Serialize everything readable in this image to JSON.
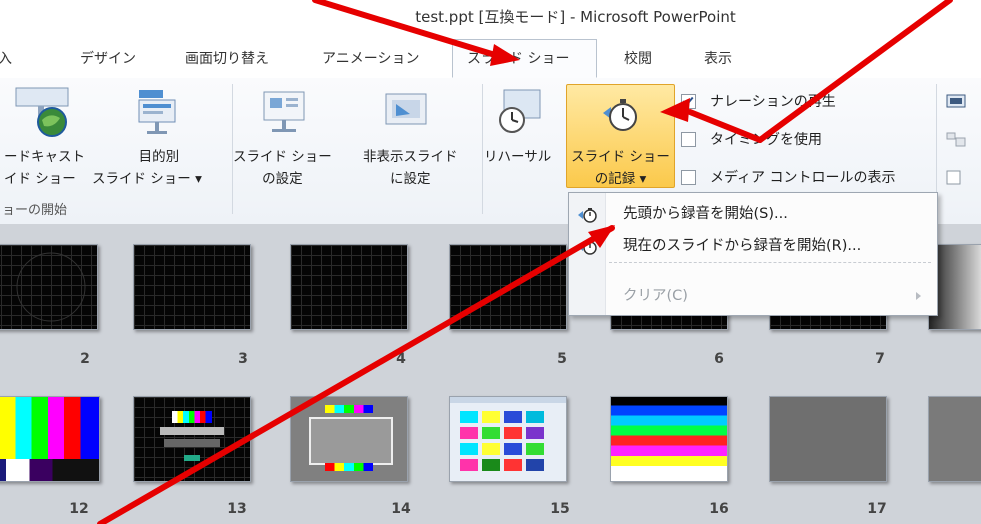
{
  "window": {
    "title": "test.ppt [互換モード] - Microsoft PowerPoint"
  },
  "tabs": [
    {
      "label": "挿入",
      "visible_label": "挿入"
    },
    {
      "label": "デザイン"
    },
    {
      "label": "画面切り替え"
    },
    {
      "label": "アニメーション"
    },
    {
      "label": "スライド ショー",
      "active": true
    },
    {
      "label": "校閲"
    },
    {
      "label": "表示"
    }
  ],
  "ribbon": {
    "broadcast": {
      "line1": "ードキャスト",
      "line2": "イド ショー"
    },
    "custom_show": {
      "line1": "目的別",
      "line2": "スライド ショー ▾"
    },
    "group_start_label": "ョーの開始",
    "setup_show": {
      "line1": "スライド ショー",
      "line2": "の設定"
    },
    "hide_slide": {
      "line1": "非表示スライド",
      "line2": "に設定"
    },
    "rehearse": {
      "label": "リハーサル"
    },
    "record": {
      "line1": "スライド ショー",
      "line2": "の記録 ▾"
    },
    "checks": [
      {
        "label": "ナレーションの再生",
        "checked": true
      },
      {
        "label": "タイミングを使用",
        "checked": false
      },
      {
        "label": "メディア コントロールの表示",
        "checked": false
      }
    ]
  },
  "menu": {
    "items": [
      {
        "label": "先頭から録音を開始(S)...",
        "enabled": true
      },
      {
        "label": "現在のスライドから録音を開始(R)...",
        "enabled": true
      },
      {
        "label": "クリア(C)",
        "enabled": false
      }
    ]
  },
  "slides": [
    {
      "num": "2"
    },
    {
      "num": "3"
    },
    {
      "num": "4"
    },
    {
      "num": "5"
    },
    {
      "num": "6"
    },
    {
      "num": "7"
    },
    {
      "num": "12"
    },
    {
      "num": "13"
    },
    {
      "num": "14"
    },
    {
      "num": "15"
    },
    {
      "num": "16"
    },
    {
      "num": "17"
    }
  ],
  "colors": {
    "accent_active_button": "#fbc94b",
    "annotation_line": "#e60000"
  }
}
